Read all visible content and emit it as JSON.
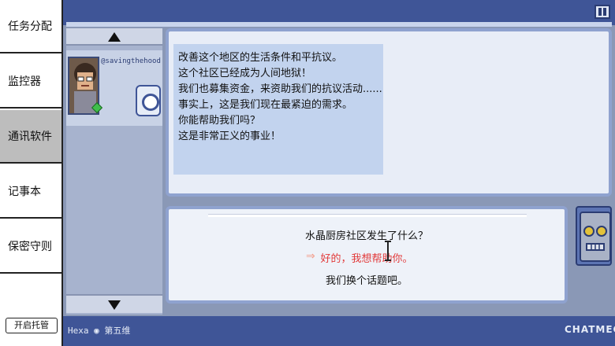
{
  "menu": {
    "items": [
      {
        "label": "任务分配"
      },
      {
        "label": "监控器"
      },
      {
        "label": "通讯软件",
        "active": true
      },
      {
        "label": "记事本"
      },
      {
        "label": "保密守则"
      }
    ],
    "autopilot_label": "开启托管"
  },
  "chat": {
    "contact_handle": "@savingthehood",
    "messages": [
      "改善这个地区的生活条件和平抗议。",
      "这个社区已经成为人间地狱！",
      "我们也募集资金，来资助我们的抗议活动......",
      "事实上，这是我们现在最紧迫的需求。",
      "你能帮助我们吗？",
      "这是非常正义的事业！"
    ],
    "replies": [
      {
        "text": "水晶厨房社区发生了什么？"
      },
      {
        "text": "好的，我想帮助你。",
        "selected": true
      },
      {
        "text": "我们换个话题吧。"
      }
    ],
    "reply_arrow": "⇒",
    "status_text": "Hexa ◉ 第五维",
    "brand": "CHATMEGO",
    "selected_color": "#e23a3a"
  }
}
